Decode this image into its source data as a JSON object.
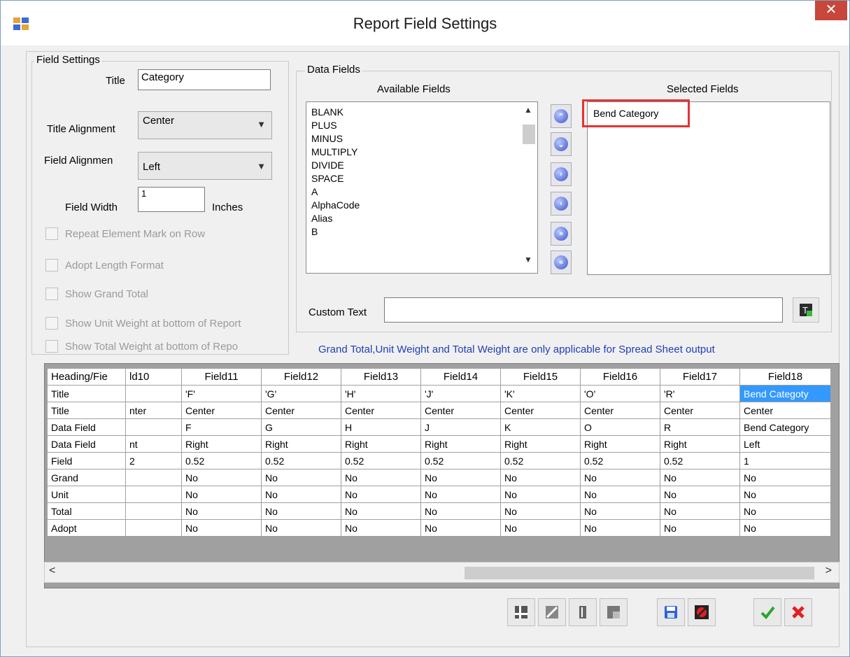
{
  "window": {
    "title": "Report Field Settings",
    "close_label": "✕"
  },
  "field_settings": {
    "legend": "Field Settings",
    "title_label": "Title",
    "title_value": "Category",
    "title_alignment_label": "Title Alignment",
    "title_alignment_value": "Center",
    "field_alignment_label": "Field Alignmen",
    "field_alignment_value": "Left",
    "field_width_label": "Field Width",
    "field_width_value": "1",
    "inches_label": "Inches",
    "checkboxes": [
      "Repeat Element Mark on Row",
      "Adopt Length Format",
      "Show Grand Total",
      "Show Unit Weight at bottom of Report",
      "Show Total Weight at bottom of Repo"
    ]
  },
  "data_fields": {
    "legend": "Data Fields",
    "available_label": "Available Fields",
    "selected_label": "Selected Fields",
    "available": [
      "BLANK",
      "PLUS",
      "MINUS",
      "MULTIPLY",
      "DIVIDE",
      "SPACE",
      "A",
      "AlphaCode",
      "Alias",
      "B"
    ],
    "selected": [
      "Bend Category"
    ],
    "custom_text_label": "Custom Text",
    "custom_text_value": ""
  },
  "note": "Grand Total,Unit Weight and Total Weight are only applicable for Spread Sheet output",
  "grid": {
    "columns": [
      "Heading/Fie",
      "ld10",
      "Field11",
      "Field12",
      "Field13",
      "Field14",
      "Field15",
      "Field16",
      "Field17",
      "Field18"
    ],
    "rows": [
      [
        "Title",
        "",
        "'F'",
        "'G'",
        "'H'",
        "'J'",
        "'K'",
        "'O'",
        "'R'",
        "Bend Categoty"
      ],
      [
        "Title",
        "nter",
        "Center",
        "Center",
        "Center",
        "Center",
        "Center",
        "Center",
        "Center",
        "Center"
      ],
      [
        "Data Field",
        "",
        "F",
        "G",
        "H",
        "J",
        "K",
        "O",
        "R",
        "Bend Category"
      ],
      [
        "Data Field",
        "nt",
        "Right",
        "Right",
        "Right",
        "Right",
        "Right",
        "Right",
        "Right",
        "Left"
      ],
      [
        "Field",
        "2",
        "0.52",
        "0.52",
        "0.52",
        "0.52",
        "0.52",
        "0.52",
        "0.52",
        "1"
      ],
      [
        "Grand",
        "",
        "No",
        "No",
        "No",
        "No",
        "No",
        "No",
        "No",
        "No"
      ],
      [
        "Unit",
        "",
        "No",
        "No",
        "No",
        "No",
        "No",
        "No",
        "No",
        "No"
      ],
      [
        "Total",
        "",
        "No",
        "No",
        "No",
        "No",
        "No",
        "No",
        "No",
        "No"
      ],
      [
        "Adopt",
        "",
        "No",
        "No",
        "No",
        "No",
        "No",
        "No",
        "No",
        "No"
      ]
    ]
  },
  "scroll": {
    "left": "<",
    "right": ">"
  },
  "icons": {
    "move_buttons": [
      "move-top-icon",
      "move-bottom-icon",
      "add-field-icon",
      "remove-field-icon",
      "add-all-icon",
      "remove-all-icon"
    ],
    "toolbar": [
      "insert-column-icon",
      "edit-column-icon",
      "move-column-icon",
      "delete-column-icon",
      "save-icon",
      "cancel-report-icon",
      "ok-icon",
      "close-dialog-icon"
    ]
  },
  "colors": {
    "selection": "#3399ff",
    "highlight_box": "#e53333",
    "note_text": "#1f3fb5",
    "ok_green": "#2aa52a",
    "cancel_red": "#e02020"
  }
}
